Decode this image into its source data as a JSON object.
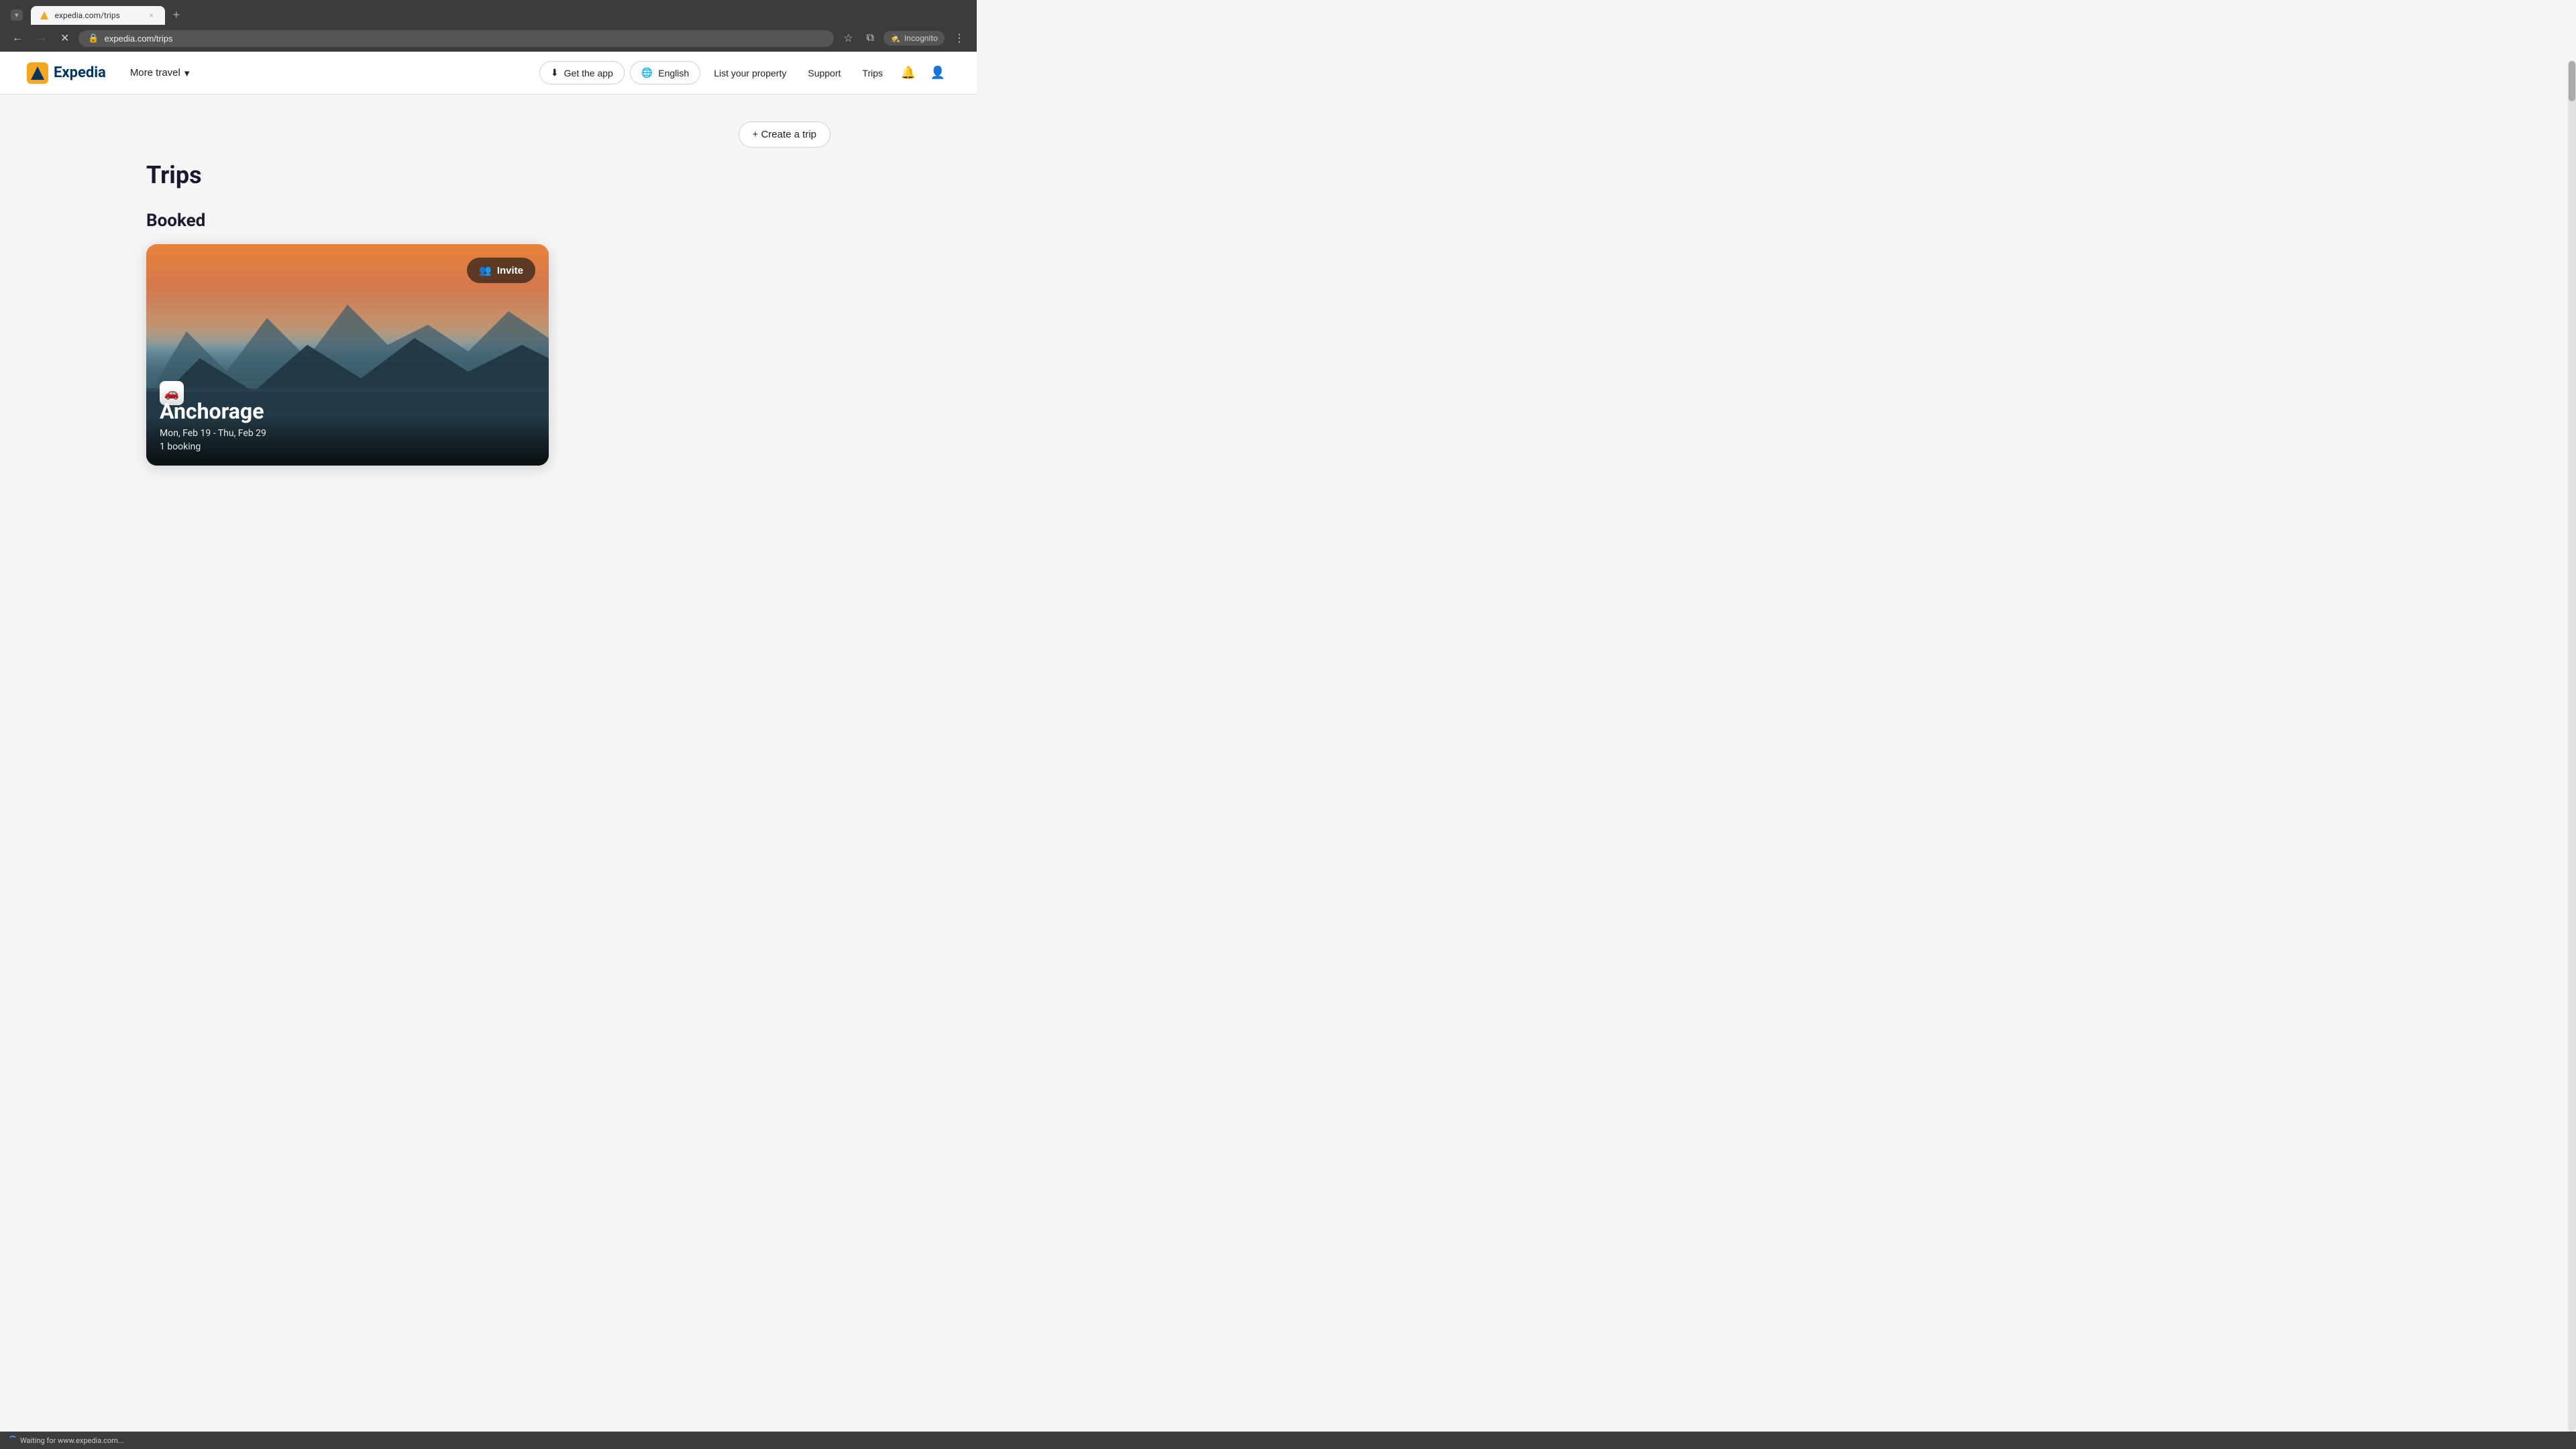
{
  "browser": {
    "tab": {
      "favicon_alt": "expedia-favicon",
      "title": "expedia.com/trips",
      "close_label": "×"
    },
    "new_tab_label": "+",
    "toolbar": {
      "back_label": "←",
      "forward_label": "→",
      "stop_label": "✕",
      "url": "expedia.com/trips",
      "bookmark_label": "☆",
      "split_view_label": "⧉",
      "incognito_label": "Incognito",
      "menu_label": "⋮"
    }
  },
  "nav": {
    "logo_text": "Expedia",
    "more_travel_label": "More travel",
    "chevron_down": "▾",
    "get_app_label": "Get the app",
    "download_icon": "⬇",
    "language_label": "English",
    "globe_icon": "🌐",
    "list_property_label": "List your property",
    "support_label": "Support",
    "trips_label": "Trips",
    "bell_icon": "🔔",
    "user_icon": "👤"
  },
  "content": {
    "create_trip_label": "+ Create a trip",
    "page_title": "Trips",
    "booked_section_label": "Booked",
    "trip_card": {
      "invite_label": "Invite",
      "invite_icon": "👥",
      "car_icon": "🚗",
      "city": "Anchorage",
      "dates": "Mon, Feb 19 - Thu, Feb 29",
      "bookings": "1 booking"
    }
  },
  "status_bar": {
    "text": "Waiting for www.expedia.com..."
  }
}
